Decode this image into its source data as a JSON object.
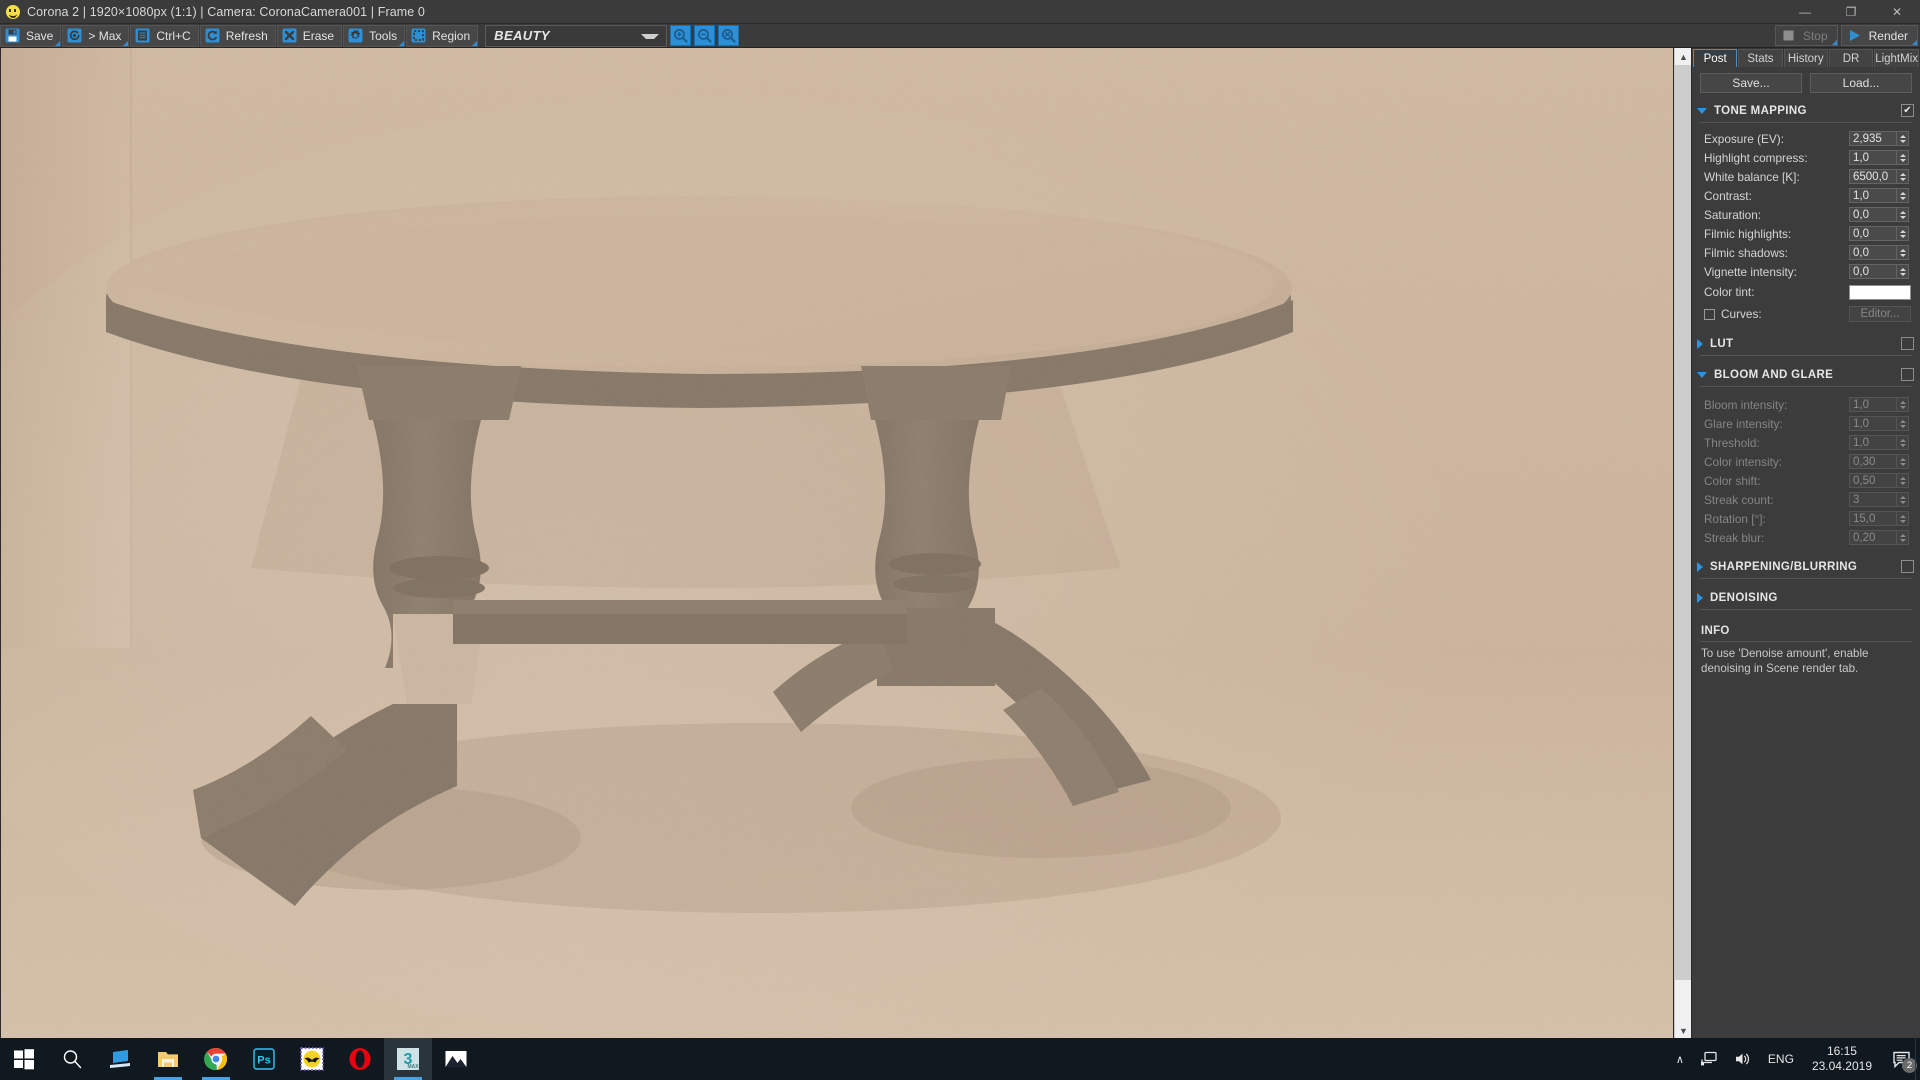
{
  "window": {
    "title": "Corona 2 | 1920×1080px (1:1) | Camera: CoronaCamera001 | Frame 0",
    "app_icon": "corona-smiley-icon",
    "minimize": "—",
    "maximize": "❐",
    "close": "✕"
  },
  "toolbar": {
    "buttons": [
      {
        "label": "Save",
        "icon": "floppy-disk-icon"
      },
      {
        "label": "> Max",
        "icon": "corona-spiral-icon"
      },
      {
        "label": "Ctrl+C",
        "icon": "clipboard-copy-icon"
      },
      {
        "label": "Refresh",
        "icon": "refresh-circle-icon"
      },
      {
        "label": "Erase",
        "icon": "x-cross-icon"
      },
      {
        "label": "Tools",
        "icon": "gear-icon"
      },
      {
        "label": "Region",
        "icon": "dashed-region-icon"
      }
    ],
    "pass_selector": {
      "value": "BEAUTY",
      "icon": "chevron-down-icon"
    },
    "zoom_buttons": [
      {
        "name": "zoom-in-icon"
      },
      {
        "name": "zoom-out-icon"
      },
      {
        "name": "zoom-reset-icon"
      }
    ],
    "stop": {
      "label": "Stop",
      "icon": "stop-square-icon",
      "enabled": false
    },
    "render": {
      "label": "Render",
      "icon": "play-triangle-icon",
      "enabled": true
    }
  },
  "viewport": {
    "vscroll": {
      "up": "▲",
      "down": "▼"
    },
    "hscroll": {
      "left": "❮",
      "right": "❯"
    }
  },
  "panel": {
    "tabs": [
      {
        "label": "Post",
        "active": true
      },
      {
        "label": "Stats",
        "active": false
      },
      {
        "label": "History",
        "active": false
      },
      {
        "label": "DR",
        "active": false
      },
      {
        "label": "LightMix",
        "active": false
      }
    ],
    "save_label": "Save...",
    "load_label": "Load...",
    "sections": {
      "tone_mapping": {
        "title": "TONE MAPPING",
        "expanded": true,
        "checked": true,
        "rows": [
          {
            "label": "Exposure (EV):",
            "value": "2,935",
            "type": "spin",
            "disabled": false
          },
          {
            "label": "Highlight compress:",
            "value": "1,0",
            "type": "spin",
            "disabled": false
          },
          {
            "label": "White balance [K]:",
            "value": "6500,0",
            "type": "spin",
            "disabled": false
          },
          {
            "label": "Contrast:",
            "value": "1,0",
            "type": "spin",
            "disabled": false
          },
          {
            "label": "Saturation:",
            "value": "0,0",
            "type": "spin",
            "disabled": false
          },
          {
            "label": "Filmic highlights:",
            "value": "0,0",
            "type": "spin",
            "disabled": false
          },
          {
            "label": "Filmic shadows:",
            "value": "0,0",
            "type": "spin",
            "disabled": false
          },
          {
            "label": "Vignette intensity:",
            "value": "0,0",
            "type": "spin",
            "disabled": false
          },
          {
            "label": "Color tint:",
            "value": "#ffffff",
            "type": "color",
            "disabled": false
          },
          {
            "label": "Curves:",
            "value": "Editor...",
            "type": "checkbox-button",
            "disabled": true,
            "checked": false
          }
        ]
      },
      "lut": {
        "title": "LUT",
        "expanded": false,
        "checked": false
      },
      "bloom_and_glare": {
        "title": "BLOOM AND GLARE",
        "expanded": true,
        "checked": false,
        "rows": [
          {
            "label": "Bloom intensity:",
            "value": "1,0",
            "type": "spin",
            "disabled": true
          },
          {
            "label": "Glare intensity:",
            "value": "1,0",
            "type": "spin",
            "disabled": true
          },
          {
            "label": "Threshold:",
            "value": "1,0",
            "type": "spin",
            "disabled": true
          },
          {
            "label": "Color intensity:",
            "value": "0,30",
            "type": "spin",
            "disabled": true
          },
          {
            "label": "Color shift:",
            "value": "0,50",
            "type": "spin",
            "disabled": true
          },
          {
            "label": "Streak count:",
            "value": "3",
            "type": "spin",
            "disabled": true
          },
          {
            "label": "Rotation [°]:",
            "value": "15,0",
            "type": "spin",
            "disabled": true
          },
          {
            "label": "Streak blur:",
            "value": "0,20",
            "type": "spin",
            "disabled": true
          }
        ]
      },
      "sharpening_blurring": {
        "title": "SHARPENING/BLURRING",
        "expanded": false,
        "checked": false
      },
      "denoising": {
        "title": "DENOISING",
        "expanded": false,
        "checked": false
      }
    },
    "info": {
      "title": "INFO",
      "text": "To use 'Denoise amount', enable denoising in Scene render tab."
    }
  },
  "taskbar": {
    "items": [
      {
        "name": "start-button",
        "icon": "windows-logo-icon"
      },
      {
        "name": "search-button",
        "icon": "search-icon"
      },
      {
        "name": "task-view-button",
        "icon": "task-view-icon"
      },
      {
        "name": "file-explorer",
        "icon": "folder-icon",
        "running": true
      },
      {
        "name": "google-chrome",
        "icon": "chrome-icon",
        "running": true
      },
      {
        "name": "photoshop",
        "icon": "photoshop-icon"
      },
      {
        "name": "app-bat",
        "icon": "bat-stamp-icon"
      },
      {
        "name": "opera-browser",
        "icon": "opera-icon"
      },
      {
        "name": "autodesk-3ds-max",
        "icon": "3dsmax-icon",
        "running": true,
        "active": true
      },
      {
        "name": "image-viewer",
        "icon": "mountain-image-icon"
      }
    ],
    "tray": {
      "show_hidden": "∧",
      "network": "network-icon",
      "volume": "speaker-icon",
      "language": "ENG",
      "time": "16:15",
      "date": "23.04.2019",
      "notifications_icon": "speech-bubble-icon",
      "notifications_count": "2"
    }
  },
  "colors": {
    "accent_blue": "#2d8fd5",
    "panel_bg": "#3c3c3c",
    "toolbar_bg": "#3b3b3b",
    "taskbar_bg": "#101820"
  }
}
